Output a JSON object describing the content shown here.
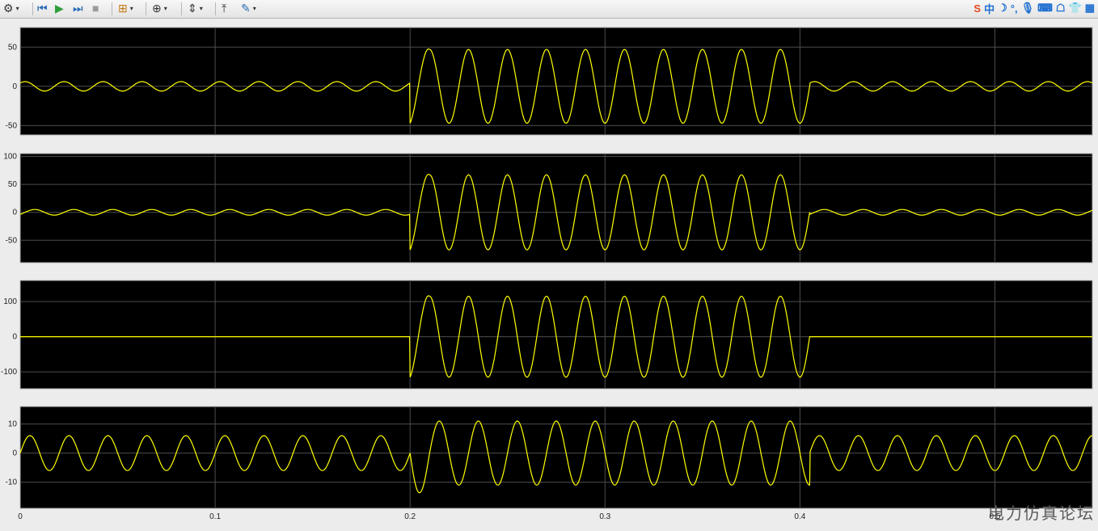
{
  "toolbar": {
    "items": [
      {
        "name": "settings-icon",
        "glyph": "⚙",
        "color": "#333333",
        "dropdown": true
      },
      {
        "name": "step-back-icon",
        "glyph": "⏮",
        "color": "#2a6db5",
        "dropdown": false
      },
      {
        "name": "run-icon",
        "glyph": "▶",
        "color": "#2e9e3a",
        "dropdown": false
      },
      {
        "name": "step-forward-icon",
        "glyph": "⏭",
        "color": "#2a6db5",
        "dropdown": false
      },
      {
        "name": "stop-icon",
        "glyph": "■",
        "color": "#9a9a9a",
        "dropdown": false
      },
      {
        "name": "signal-select-icon",
        "glyph": "⊞",
        "color": "#c47a16",
        "dropdown": true
      },
      {
        "name": "zoom-in-icon",
        "glyph": "⊕",
        "color": "#333333",
        "dropdown": true
      },
      {
        "name": "autoscale-icon",
        "glyph": "⇕",
        "color": "#333333",
        "dropdown": true
      },
      {
        "name": "cursor-measure-icon",
        "glyph": "⤒",
        "color": "#333333",
        "dropdown": false
      },
      {
        "name": "highlight-icon",
        "glyph": "✎",
        "color": "#2a6db5",
        "dropdown": true
      }
    ],
    "ime_items": [
      {
        "name": "sogou-logo-icon",
        "glyph": "S",
        "color": "#e8481f"
      },
      {
        "name": "ime-chinese-mode-icon",
        "glyph": "中",
        "color": "#1f6fd1"
      },
      {
        "name": "ime-halfwidth-icon",
        "glyph": "☽",
        "color": "#1f6fd1"
      },
      {
        "name": "ime-punctuation-icon",
        "glyph": "°,",
        "color": "#1f6fd1"
      },
      {
        "name": "microphone-icon",
        "glyph": "🎙",
        "color": "#1f6fd1"
      },
      {
        "name": "keyboard-icon",
        "glyph": "⌨",
        "color": "#1f6fd1"
      },
      {
        "name": "skin-icon",
        "glyph": "☖",
        "color": "#1f6fd1"
      },
      {
        "name": "shirt-icon",
        "glyph": "👕",
        "color": "#1f6fd1"
      },
      {
        "name": "grid-menu-icon",
        "glyph": "▦",
        "color": "#1f6fd1"
      }
    ]
  },
  "colors": {
    "plot_background": "#000000",
    "trace": "#ffff00",
    "grid": "#4d4d4d",
    "axes_border": "#b0b0b0",
    "tick_label": "#222222",
    "figure_background": "#ececec"
  },
  "watermark": "电力仿真论坛",
  "chart_data": [
    {
      "type": "line",
      "xlim": [
        0,
        0.55
      ],
      "ylim": [
        -62,
        75
      ],
      "yticks": [
        -50,
        0,
        50
      ],
      "yticklabels": [
        "-50",
        "0",
        "50"
      ],
      "xticks": [
        0,
        0.1,
        0.2,
        0.3,
        0.4,
        0.5
      ],
      "xticklabels": [],
      "grid": true,
      "series": [
        {
          "segments": [
            {
              "t": [
                0,
                0.2
              ],
              "amplitude": 6,
              "frequency": 50,
              "phase_deg": 45
            },
            {
              "t": [
                0.2,
                0.405
              ],
              "amplitude": 47,
              "frequency": 50,
              "phase_deg": -90,
              "first_peak": 64
            },
            {
              "t": [
                0.405,
                0.55
              ],
              "amplitude": 6,
              "frequency": 50,
              "phase_deg": 45
            }
          ]
        }
      ]
    },
    {
      "type": "line",
      "xlim": [
        0,
        0.55
      ],
      "ylim": [
        -90,
        105
      ],
      "yticks": [
        -50,
        0,
        50,
        100
      ],
      "yticklabels": [
        "-50",
        "0",
        "50",
        "100"
      ],
      "xticks": [
        0,
        0.1,
        0.2,
        0.3,
        0.4,
        0.5
      ],
      "xticklabels": [],
      "grid": true,
      "series": [
        {
          "segments": [
            {
              "t": [
                0,
                0.2
              ],
              "amplitude": 5,
              "frequency": 50,
              "phase_deg": -45
            },
            {
              "t": [
                0.2,
                0.405
              ],
              "amplitude": 67,
              "frequency": 50,
              "phase_deg": -90,
              "first_peak": 92
            },
            {
              "t": [
                0.405,
                0.55
              ],
              "amplitude": 5,
              "frequency": 50,
              "phase_deg": -45
            }
          ]
        }
      ]
    },
    {
      "type": "line",
      "xlim": [
        0,
        0.55
      ],
      "ylim": [
        -148,
        160
      ],
      "yticks": [
        -100,
        0,
        100
      ],
      "yticklabels": [
        "-100",
        "0",
        "100"
      ],
      "xticks": [
        0,
        0.1,
        0.2,
        0.3,
        0.4,
        0.5
      ],
      "xticklabels": [],
      "grid": true,
      "series": [
        {
          "segments": [
            {
              "t": [
                0,
                0.2
              ],
              "amplitude": 0,
              "frequency": 50,
              "phase_deg": 0
            },
            {
              "t": [
                0.2,
                0.405
              ],
              "amplitude": 115,
              "frequency": 50,
              "phase_deg": -90,
              "first_peak": 155
            },
            {
              "t": [
                0.405,
                0.55
              ],
              "amplitude": 0,
              "frequency": 50,
              "phase_deg": 0
            }
          ]
        }
      ]
    },
    {
      "type": "line",
      "xlim": [
        0,
        0.55
      ],
      "ylim": [
        -19,
        16
      ],
      "yticks": [
        -10,
        0,
        10
      ],
      "yticklabels": [
        "-10",
        "0",
        "10"
      ],
      "xticks": [
        0,
        0.1,
        0.2,
        0.3,
        0.4,
        0.5
      ],
      "xticklabels": [
        "0",
        "0.1",
        "0.2",
        "0.3",
        "0.4",
        "0.5"
      ],
      "grid": true,
      "series": [
        {
          "segments": [
            {
              "t": [
                0,
                0.2
              ],
              "amplitude": 6,
              "frequency": 50,
              "phase_deg": 0
            },
            {
              "t": [
                0.2,
                0.405
              ],
              "amplitude": 11,
              "frequency": 50,
              "phase_deg": 180,
              "first_peak": -15
            },
            {
              "t": [
                0.405,
                0.55
              ],
              "amplitude": 6,
              "frequency": 50,
              "phase_deg": 0
            }
          ]
        }
      ]
    }
  ]
}
